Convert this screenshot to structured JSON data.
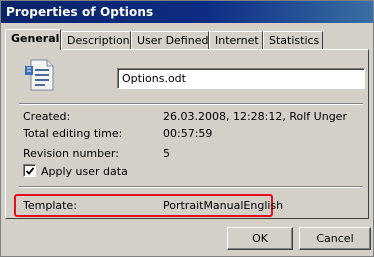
{
  "window": {
    "title": "Properties of Options"
  },
  "tabs": [
    {
      "label": "General",
      "active": true
    },
    {
      "label": "Description",
      "active": false
    },
    {
      "label": "User Defined",
      "active": false
    },
    {
      "label": "Internet",
      "active": false
    },
    {
      "label": "Statistics",
      "active": false
    }
  ],
  "file": {
    "name": "Options.odt",
    "icon": "document-icon"
  },
  "info": {
    "created_label": "Created:",
    "created_value": "26.03.2008, 12:28:12, Rolf Unger",
    "editing_label": "Total editing time:",
    "editing_value": "00:57:59",
    "revision_label": "Revision number:",
    "revision_value": "5"
  },
  "apply_user_data": {
    "label": "Apply user data",
    "checked": true
  },
  "template": {
    "label": "Template:",
    "value": "PortraitManualEnglish"
  },
  "buttons": {
    "ok": "OK",
    "cancel": "Cancel"
  },
  "colors": {
    "titlebar": "#0a246a",
    "face": "#d4d0c8",
    "highlight_border": "#e3101a"
  }
}
